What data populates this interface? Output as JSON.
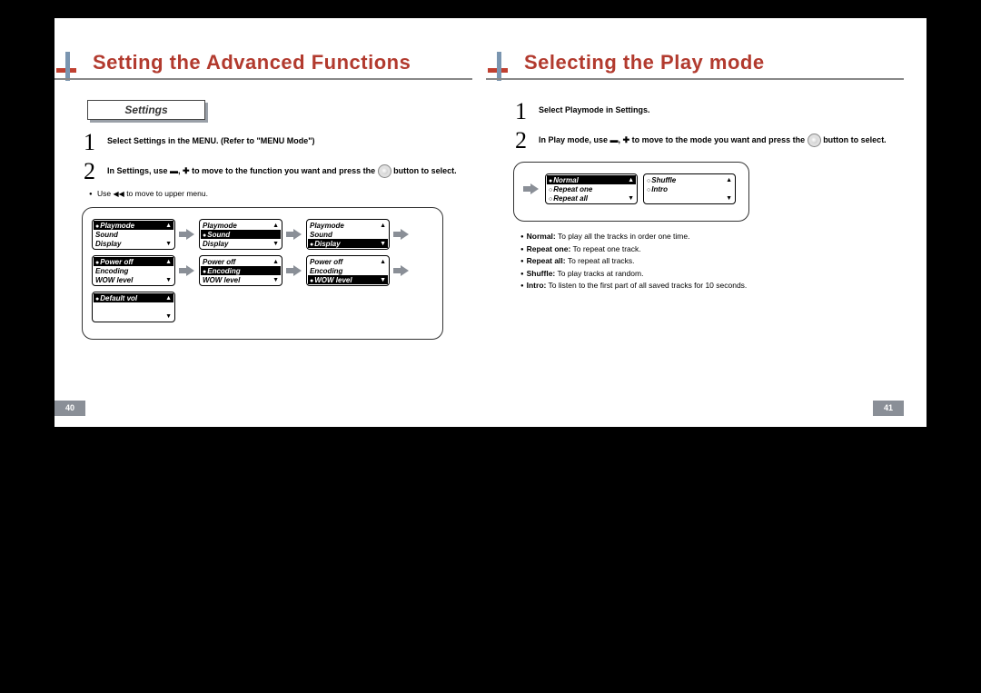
{
  "left": {
    "title": "Setting the Advanced Functions",
    "subhead": "Settings",
    "step1": "Select Settings in the MENU. (Refer to \"MENU Mode\")",
    "step2a": "In Settings, use",
    "step2b": "to move to the function you want and press the",
    "step2c": "button to select.",
    "footnote_a": "Use",
    "footnote_b": "to move to upper menu.",
    "rew_sym": "◀◀",
    "lcd": {
      "r1c1": [
        "Playmode",
        "Sound",
        "Display"
      ],
      "r1c2": [
        "Playmode",
        "Sound",
        "Display"
      ],
      "r1c3": [
        "Playmode",
        "Sound",
        "Display"
      ],
      "r2c1": [
        "Power off",
        "Encoding",
        "WOW level"
      ],
      "r2c2": [
        "Power off",
        "Encoding",
        "WOW level"
      ],
      "r2c3": [
        "Power off",
        "Encoding",
        "WOW level"
      ],
      "r3c1": [
        "Default vol",
        "",
        ""
      ]
    },
    "page_num": "40"
  },
  "right": {
    "title": "Selecting the Play mode",
    "step1": "Select Playmode in Settings.",
    "step2a": "In Play mode, use",
    "step2b": "to move to the mode you want and press the",
    "step2c": "button to select.",
    "lcd": {
      "l": [
        "Normal",
        "Repeat one",
        "Repeat all"
      ],
      "r": [
        "Shuffle",
        "Intro",
        ""
      ]
    },
    "bullets": [
      {
        "k": "Normal:",
        "v": " To play all the tracks in order one time."
      },
      {
        "k": "Repeat one:",
        "v": " To repeat one track."
      },
      {
        "k": "Repeat all:",
        "v": " To repeat all tracks."
      },
      {
        "k": "Shuffle:",
        "v": " To play tracks at random."
      },
      {
        "k": "Intro:",
        "v": " To listen to the first part of all saved tracks for 10 seconds."
      }
    ],
    "page_num": "41"
  },
  "sym": {
    "minus": "▬",
    "plus": "✚"
  }
}
